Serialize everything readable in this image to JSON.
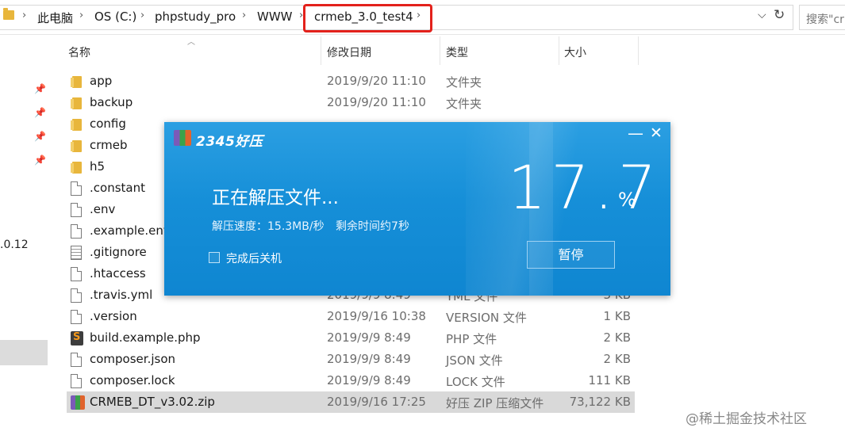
{
  "address_bar": {
    "crumbs": [
      "此电脑",
      "OS (C:)",
      "phpstudy_pro",
      "WWW",
      "crmeb_3.0_test4"
    ],
    "search_placeholder": "搜索\"cr"
  },
  "nav_pane": {
    "partial_text": ".0.12"
  },
  "columns": {
    "name": "名称",
    "date": "修改日期",
    "type": "类型",
    "size": "大小"
  },
  "files": [
    {
      "name": "app",
      "date": "2019/9/20 11:10",
      "type": "文件夹",
      "size": "",
      "icon": "folder-icon"
    },
    {
      "name": "backup",
      "date": "2019/9/20 11:10",
      "type": "文件夹",
      "size": "",
      "icon": "folder-icon"
    },
    {
      "name": "config",
      "date": "",
      "type": "",
      "size": "",
      "icon": "folder-icon"
    },
    {
      "name": "crmeb",
      "date": "",
      "type": "",
      "size": "",
      "icon": "folder-icon"
    },
    {
      "name": "h5",
      "date": "",
      "type": "",
      "size": "",
      "icon": "folder-icon"
    },
    {
      "name": ".constant",
      "date": "",
      "type": "",
      "size": "",
      "icon": "file-icon"
    },
    {
      "name": ".env",
      "date": "",
      "type": "",
      "size": "",
      "icon": "file-icon"
    },
    {
      "name": ".example.env",
      "date": "",
      "type": "",
      "size": "",
      "icon": "file-icon"
    },
    {
      "name": ".gitignore",
      "date": "",
      "type": "",
      "size": "",
      "icon": "text-file-icon"
    },
    {
      "name": ".htaccess",
      "date": "",
      "type": "",
      "size": "",
      "icon": "file-icon"
    },
    {
      "name": ".travis.yml",
      "date": "2019/9/9 8:49",
      "type": "YML 文件",
      "size": "3 KB",
      "icon": "file-icon"
    },
    {
      "name": ".version",
      "date": "2019/9/16 10:38",
      "type": "VERSION 文件",
      "size": "1 KB",
      "icon": "file-icon"
    },
    {
      "name": "build.example.php",
      "date": "2019/9/9 8:49",
      "type": "PHP 文件",
      "size": "2 KB",
      "icon": "sublime-file-icon"
    },
    {
      "name": "composer.json",
      "date": "2019/9/9 8:49",
      "type": "JSON 文件",
      "size": "2 KB",
      "icon": "file-icon"
    },
    {
      "name": "composer.lock",
      "date": "2019/9/9 8:49",
      "type": "LOCK 文件",
      "size": "111 KB",
      "icon": "file-icon"
    },
    {
      "name": "CRMEB_DT_v3.02.zip",
      "date": "2019/9/16 17:25",
      "type": "好压 ZIP 压缩文件",
      "size": "73,122 KB",
      "icon": "zip-archive-icon",
      "selected": true
    }
  ],
  "dialog": {
    "brand": "2345好压",
    "title": "正在解压文件...",
    "speed": "解压速度：15.3MB/秒",
    "remaining": "剩余时间约7秒",
    "percent": "17.7",
    "percent_sign": "%",
    "progress_fraction": 0.177,
    "shutdown_label": "完成后关机",
    "pause_label": "暂停",
    "minimize_glyph": "—",
    "close_glyph": "✕"
  },
  "watermark": "@稀土掘金技术社区",
  "colors": {
    "dialog_blue": "#168fd8",
    "highlight_red": "#e3211b",
    "folder_yellow": "#e8b63c"
  }
}
